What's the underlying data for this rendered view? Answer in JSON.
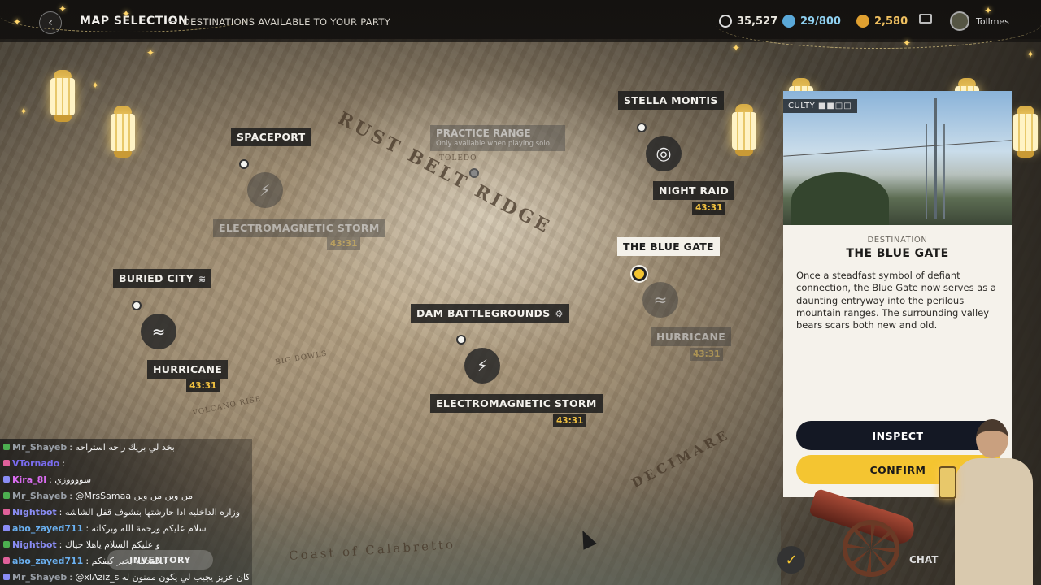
{
  "header": {
    "title": "MAP SELECTION",
    "subtitle": "DESTINATIONS AVAILABLE TO YOUR PARTY",
    "currency": [
      {
        "icon": "coin-icon",
        "value": "35,527"
      },
      {
        "icon": "raider-token-icon",
        "value": "29/800"
      },
      {
        "icon": "credit-icon",
        "value": "2,580"
      }
    ],
    "user": "Tollmes"
  },
  "map": {
    "terrain": [
      "RUST BELT RIDGE",
      "DECIMARE",
      "Coast of Calabretto",
      "BIG BOWLS",
      "VOLCANO RISE",
      "TOLEDO"
    ],
    "locations": [
      {
        "name": "SPACEPORT"
      },
      {
        "name": "STELLA MONTIS"
      },
      {
        "name": "BURIED CITY"
      },
      {
        "name": "DAM BATTLEGROUNDS"
      },
      {
        "name": "THE BLUE GATE"
      }
    ],
    "practice": {
      "name": "PRACTICE RANGE",
      "note": "Only available when playing solo."
    },
    "events": [
      {
        "name": "ELECTROMAGNETIC STORM",
        "timer": "43:31"
      },
      {
        "name": "NIGHT RAID",
        "timer": "43:31"
      },
      {
        "name": "HURRICANE",
        "timer": "43:31"
      },
      {
        "name": "HURRICANE",
        "timer": "43:31"
      },
      {
        "name": "ELECTROMAGNETIC STORM",
        "timer": "43:31"
      }
    ]
  },
  "panel": {
    "difficulty_label": "CULTY",
    "kicker": "DESTINATION",
    "name": "THE BLUE GATE",
    "description": "Once a steadfast symbol of defiant connection, the Blue Gate now serves as a daunting entryway into the perilous mountain ranges. The surrounding valley bears scars both new and old.",
    "inspect_label": "INSPECT",
    "confirm_label": "CONFIRM"
  },
  "chat": [
    {
      "user": "Mr_Shayeb",
      "msg": ": بخد لي بريك راحه استراحه",
      "color": "#9aa0a8"
    },
    {
      "user": "VTornado",
      "msg": ":",
      "color": "#7a6cf0"
    },
    {
      "user": "Kira_8l",
      "msg": ": سووووزي",
      "color": "#d96cf0"
    },
    {
      "user": "Mr_Shayeb",
      "msg": ": @MrsSamaa من وين من وين",
      "color": "#9aa0a8"
    },
    {
      "user": "Nightbot",
      "msg": ": وزاره الداخليه اذا حارشتها بتشوف قفل الشاشه",
      "color": "#8a8df5"
    },
    {
      "user": "abo_zayed711",
      "msg": ": سلام عليكم ورحمة الله وبركاته",
      "color": "#6ab0f0"
    },
    {
      "user": "Nightbot",
      "msg": ": و عليكم السلام ياهلا حياك",
      "color": "#8a8df5"
    },
    {
      "user": "abo_zayed711",
      "msg": ": الحمدلله بخير كيفكم",
      "color": "#6ab0f0"
    },
    {
      "user": "Mr_Shayeb",
      "msg": ": @xlAziz_s كان عزيز يجيب لي يكون ممنون له",
      "color": "#9aa0a8"
    }
  ],
  "bottom": {
    "inventory_label": "INVENTORY",
    "chat_label": "CHAT"
  },
  "colors": {
    "accent": "#f4c531",
    "dark_button": "#141824",
    "panel_bg": "#f5f2eb"
  }
}
